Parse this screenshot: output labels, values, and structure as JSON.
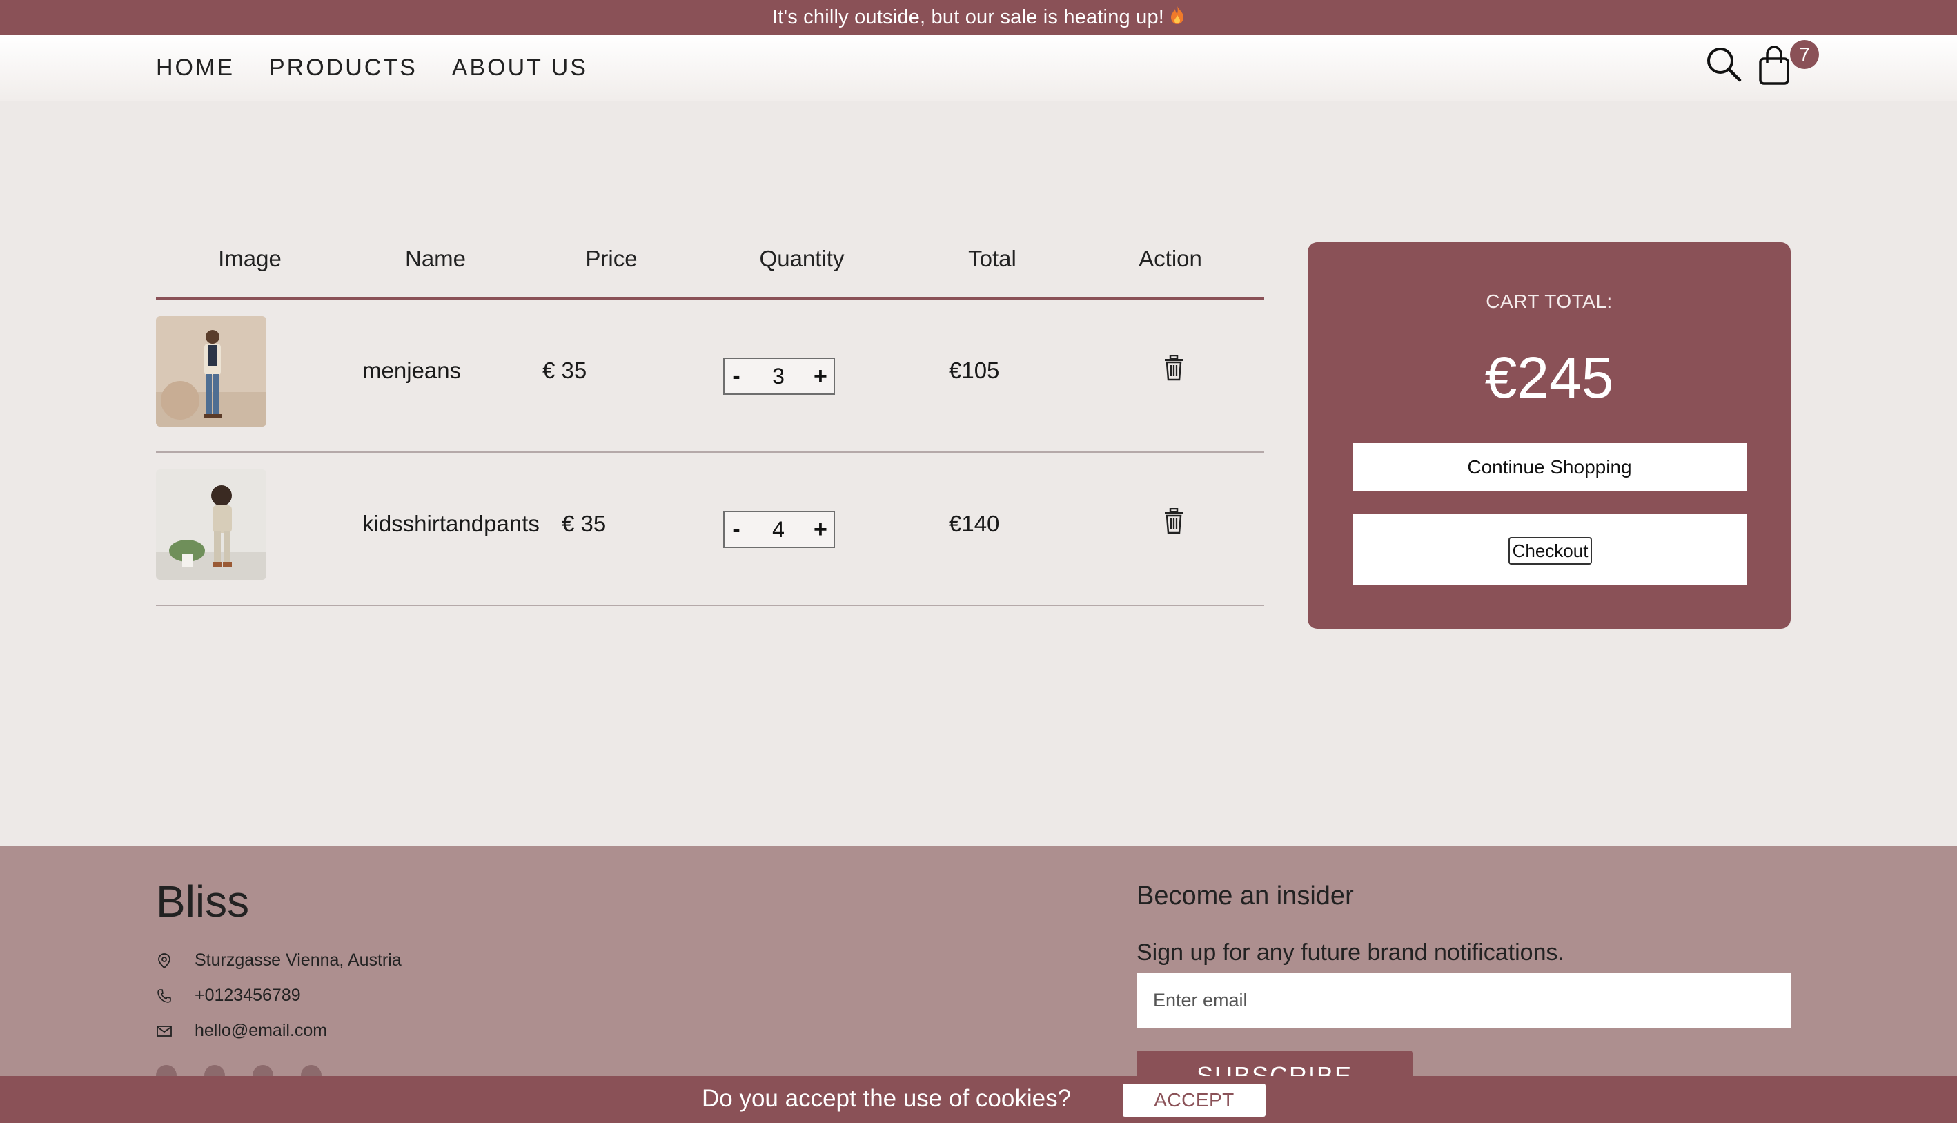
{
  "promo": {
    "text": "It's chilly outside, but our sale is heating up!",
    "icon": "fire-icon"
  },
  "nav": {
    "items": [
      "HOME",
      "PRODUCTS",
      "ABOUT US"
    ]
  },
  "header": {
    "cart_count": "7",
    "search_icon": "search-icon",
    "cart_icon": "shopping-bag-icon"
  },
  "cart": {
    "columns": [
      "Image",
      "Name",
      "Price",
      "Quantity",
      "Total",
      "Action"
    ],
    "items": [
      {
        "name": "menjeans",
        "price": "€ 35",
        "quantity": "3",
        "minus": "-",
        "plus": "+",
        "total": "€105",
        "image": "man-in-jeans-photo"
      },
      {
        "name": "kidsshirtandpants",
        "price": "€ 35",
        "quantity": "4",
        "minus": "-",
        "plus": "+",
        "total": "€140",
        "image": "child-outfit-photo"
      }
    ]
  },
  "summary": {
    "label": "CART TOTAL:",
    "amount": "€245",
    "continue_label": "Continue Shopping",
    "checkout_label": "Checkout"
  },
  "footer": {
    "brand": "Bliss",
    "address": "Sturzgasse Vienna, Austria",
    "phone": "+0123456789",
    "email": "hello@email.com",
    "insider_title": "Become an insider",
    "insider_sub": "Sign up for any future brand notifications.",
    "email_placeholder": "Enter email",
    "subscribe_label": "SUBSCRIBE"
  },
  "cookie": {
    "question": "Do you accept the use of cookies?",
    "accept_label": "ACCEPT"
  },
  "colors": {
    "accent": "#8a5157",
    "background": "#ede9e7",
    "footer": "#ad8f8f"
  }
}
